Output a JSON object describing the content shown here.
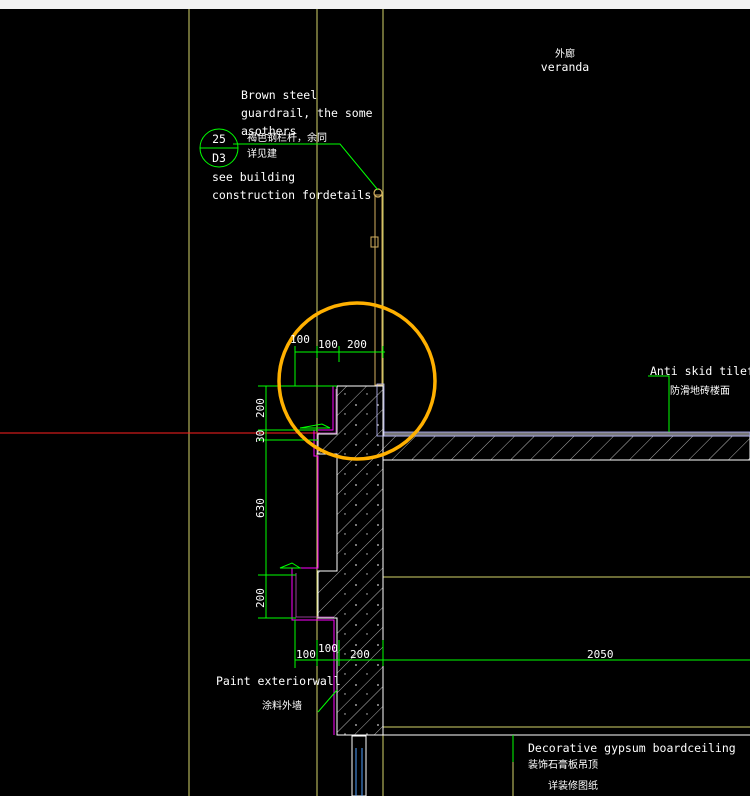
{
  "labels": {
    "veranda_cn": "外廊",
    "veranda_en": "veranda",
    "guardrail_en_1": "Brown steel",
    "guardrail_en_2": "guardrail, the some",
    "guardrail_en_3": "asothers",
    "guardrail_cn_1": "褐色钢栏杆，余同",
    "guardrail_cn_2": "详见建",
    "ref_num": "25",
    "ref_sheet": "D3",
    "see_building_1": "see building",
    "see_building_2": "construction fordetails",
    "floor_en": "Anti skid tilefloo",
    "floor_cn": "防滑地砖楼面",
    "paint_en": "Paint exteriorwall",
    "paint_cn": "涂料外墙",
    "ceiling_en": "Decorative gypsum boardceiling",
    "ceiling_cn_1": "装饰石膏板吊顶",
    "ceiling_cn_2": "详装修图纸"
  },
  "dimensions": {
    "d100_top_left": "100",
    "d100_top_mid": "100",
    "d200_top": "200",
    "d200_left_upper": "200",
    "d30": "30",
    "d630": "630",
    "d200_left_lower": "200",
    "d100_bottom_left": "100",
    "d100_bottom_mid": "100",
    "d200_bottom": "200",
    "d2050": "2050"
  },
  "colors": {
    "background": "#000000",
    "dimension_line": "#00ff00",
    "guide_line": "#d4d46a",
    "section_outline": "#ff00ff",
    "hatch": "#ffffff",
    "highlight_circle": "#ffb000",
    "axis_line": "#ff2020"
  }
}
